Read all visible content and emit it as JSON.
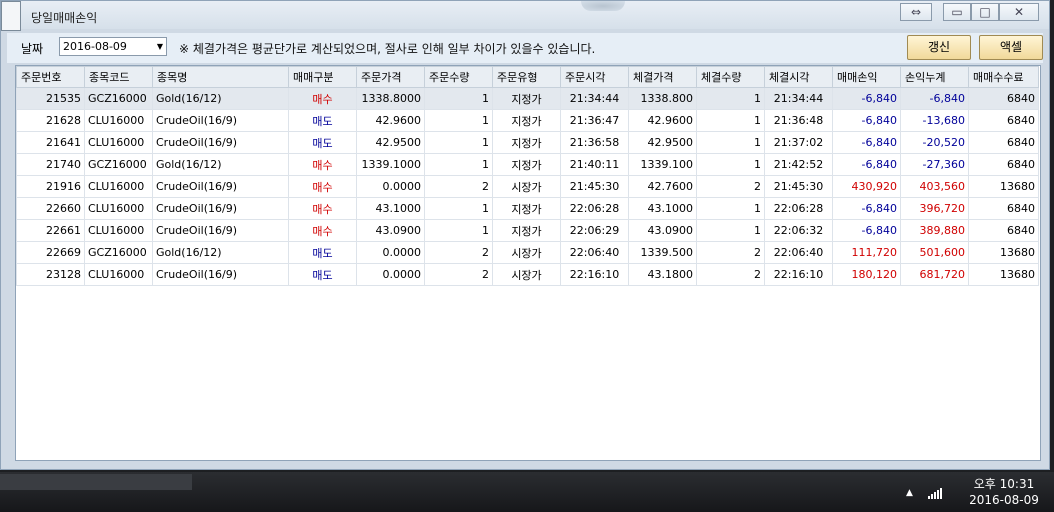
{
  "window": {
    "title": "당일매매손익"
  },
  "toolbar": {
    "date_label": "날짜",
    "date_value": "2016-08-09",
    "note": "※ 체결가격은 평균단가로 계산되었으며, 절사로 인해 일부 차이가 있을수 있습니다.",
    "refresh_label": "갱신",
    "excel_label": "액셀"
  },
  "table": {
    "headers": [
      "주문번호",
      "종목코드",
      "종목명",
      "매매구분",
      "주문가격",
      "주문수량",
      "주문유형",
      "주문시각",
      "체결가격",
      "체결수량",
      "체결시각",
      "매매손익",
      "손익누계",
      "매매수수료"
    ],
    "rows": [
      [
        "21535",
        "GCZ16000",
        "Gold(16/12)",
        "매수",
        "1338.8000",
        "1",
        "지정가",
        "21:34:44",
        "1338.800",
        "1",
        "21:34:44",
        "-6,840",
        "-6,840",
        "6840"
      ],
      [
        "21628",
        "CLU16000",
        "CrudeOil(16/9)",
        "매도",
        "42.9600",
        "1",
        "지정가",
        "21:36:47",
        "42.9600",
        "1",
        "21:36:48",
        "-6,840",
        "-13,680",
        "6840"
      ],
      [
        "21641",
        "CLU16000",
        "CrudeOil(16/9)",
        "매도",
        "42.9500",
        "1",
        "지정가",
        "21:36:58",
        "42.9500",
        "1",
        "21:37:02",
        "-6,840",
        "-20,520",
        "6840"
      ],
      [
        "21740",
        "GCZ16000",
        "Gold(16/12)",
        "매수",
        "1339.1000",
        "1",
        "지정가",
        "21:40:11",
        "1339.100",
        "1",
        "21:42:52",
        "-6,840",
        "-27,360",
        "6840"
      ],
      [
        "21916",
        "CLU16000",
        "CrudeOil(16/9)",
        "매수",
        "0.0000",
        "2",
        "시장가",
        "21:45:30",
        "42.7600",
        "2",
        "21:45:30",
        "430,920",
        "403,560",
        "13680"
      ],
      [
        "22660",
        "CLU16000",
        "CrudeOil(16/9)",
        "매수",
        "43.1000",
        "1",
        "지정가",
        "22:06:28",
        "43.1000",
        "1",
        "22:06:28",
        "-6,840",
        "396,720",
        "6840"
      ],
      [
        "22661",
        "CLU16000",
        "CrudeOil(16/9)",
        "매수",
        "43.0900",
        "1",
        "지정가",
        "22:06:29",
        "43.0900",
        "1",
        "22:06:32",
        "-6,840",
        "389,880",
        "6840"
      ],
      [
        "22669",
        "GCZ16000",
        "Gold(16/12)",
        "매도",
        "0.0000",
        "2",
        "시장가",
        "22:06:40",
        "1339.500",
        "2",
        "22:06:40",
        "111,720",
        "501,600",
        "13680"
      ],
      [
        "23128",
        "CLU16000",
        "CrudeOil(16/9)",
        "매도",
        "0.0000",
        "2",
        "시장가",
        "22:16:10",
        "43.1800",
        "2",
        "22:16:10",
        "180,120",
        "681,720",
        "13680"
      ]
    ]
  },
  "taskbar": {
    "time": "오후 10:31",
    "date": "2016-08-09"
  },
  "colors": {
    "buy": "#d00000",
    "sell": "#000099",
    "profit": "#d00000",
    "loss": "#000099"
  },
  "icons": {
    "restore_swap": "swap-arrows-icon",
    "minimize": "minimize-icon",
    "maximize": "maximize-icon",
    "close": "close-icon"
  }
}
